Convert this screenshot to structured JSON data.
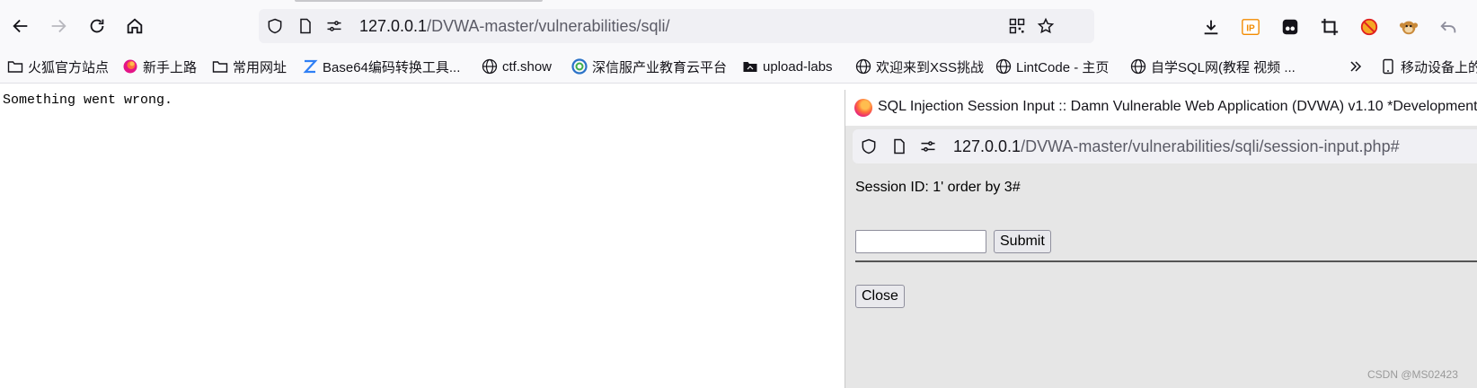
{
  "browser": {
    "url": {
      "host": "127.0.0.1",
      "path": "/DVWA-master/vulnerabilities/sqli/"
    },
    "right_icons": [
      "download-icon",
      "ip-icon",
      "extension-icon",
      "crop-icon",
      "blocked-icon",
      "monkey-icon",
      "undo-icon"
    ]
  },
  "bookmarks": [
    {
      "label": "火狐官方站点",
      "icon": "folder-icon"
    },
    {
      "label": "新手上路",
      "icon": "firefox-icon"
    },
    {
      "label": "常用网址",
      "icon": "folder-icon"
    },
    {
      "label": "Base64编码转换工具...",
      "icon": "z-icon"
    },
    {
      "label": "ctf.show",
      "icon": "globe-icon"
    },
    {
      "label": "深信服产业教育云平台",
      "icon": "sangfor-icon"
    },
    {
      "label": "upload-labs",
      "icon": "folder-dark-icon"
    },
    {
      "label": "欢迎来到XSS挑战",
      "icon": "globe-icon"
    },
    {
      "label": "LintCode - 主页",
      "icon": "globe-icon"
    },
    {
      "label": "自学SQL网(教程 视频 ...",
      "icon": "globe-icon"
    }
  ],
  "bookmarks_mobile": "移动设备上的",
  "page": {
    "error_text": "Something went wrong."
  },
  "popup": {
    "title": "SQL Injection Session Input :: Damn Vulnerable Web Application (DVWA) v1.10 *Development",
    "url": {
      "host": "127.0.0.1",
      "path": "/DVWA-master/vulnerabilities/sqli/session-input.php#"
    },
    "session_label": "Session ID: 1' order by 3#",
    "input_value": "",
    "submit_label": "Submit",
    "close_label": "Close"
  },
  "watermark": "CSDN @MS02423"
}
